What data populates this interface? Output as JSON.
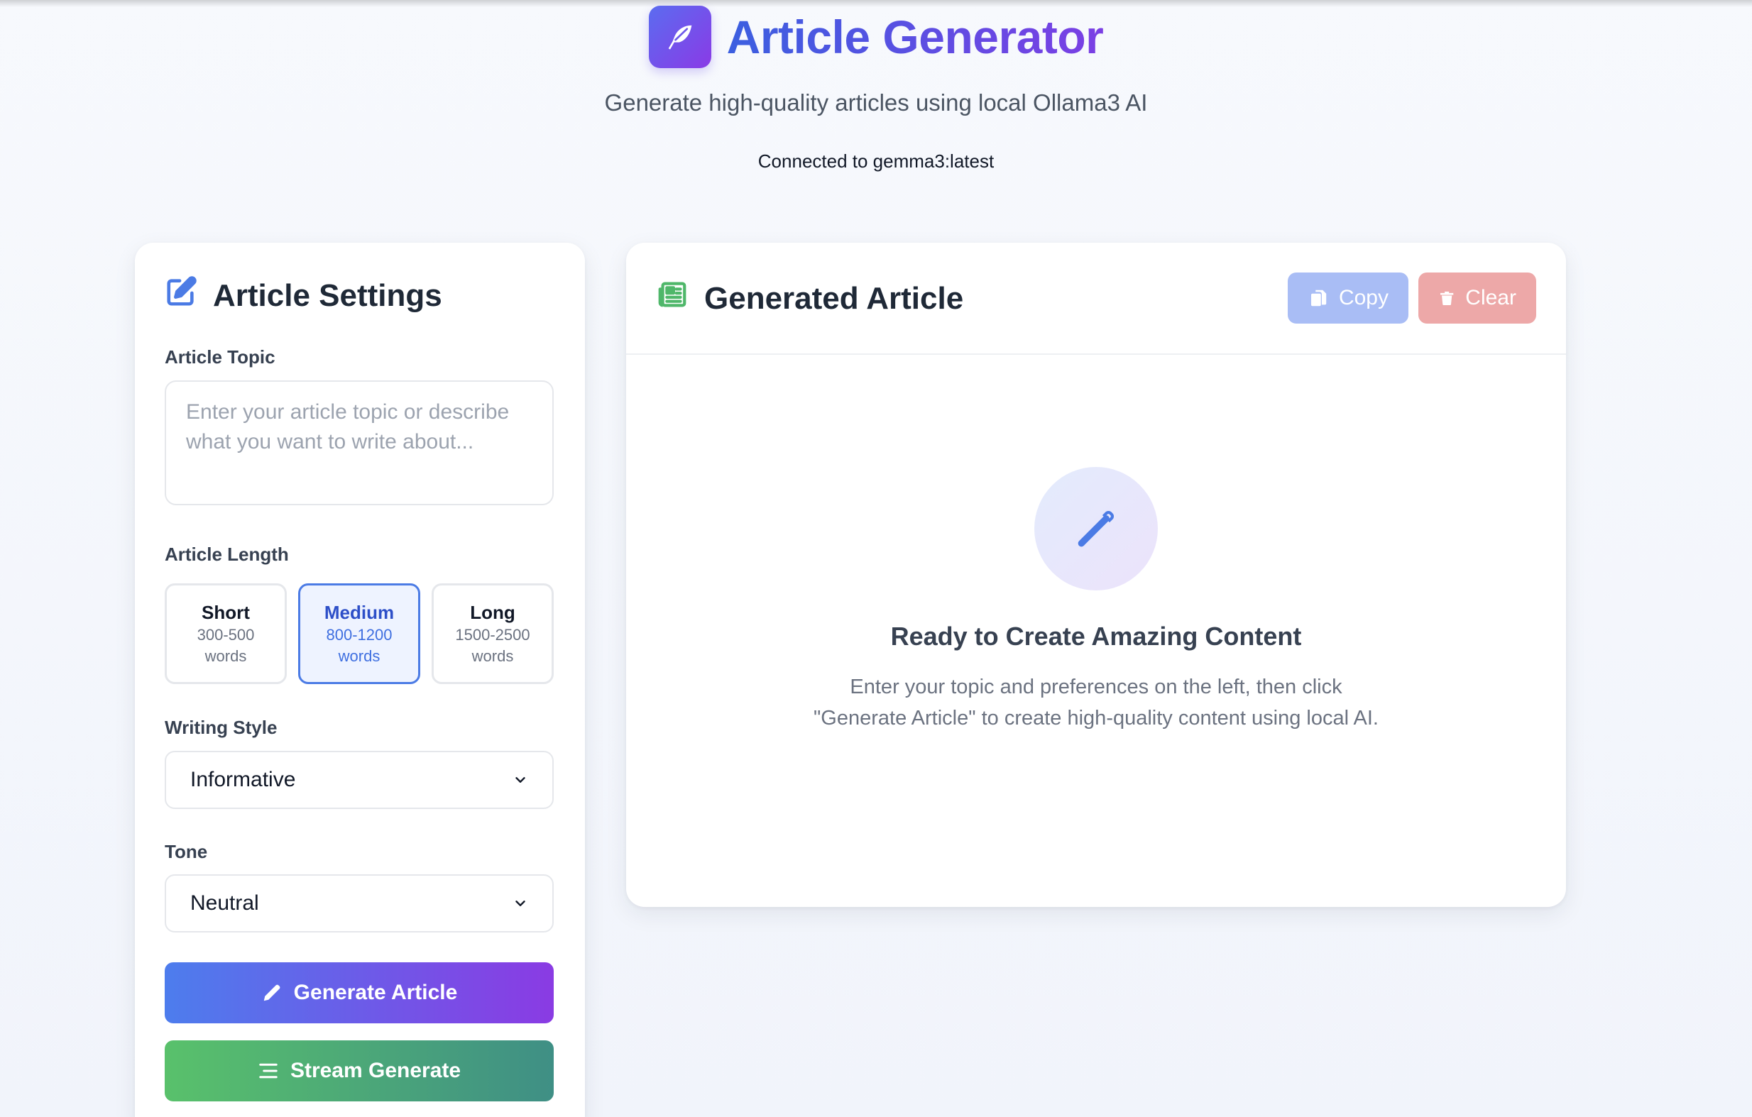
{
  "header": {
    "title": "Article Generator",
    "subtitle": "Generate high-quality articles using local Ollama3 AI",
    "connection_status": "Connected to gemma3:latest",
    "logo_icon": "feather-icon"
  },
  "settings": {
    "title": "Article Settings",
    "title_icon": "edit-square-icon",
    "topic": {
      "label": "Article Topic",
      "placeholder": "Enter your article topic or describe what you want to write about...",
      "value": ""
    },
    "length": {
      "label": "Article Length",
      "selected": "Medium",
      "options": [
        {
          "name": "Short",
          "range": "300-500",
          "unit": "words"
        },
        {
          "name": "Medium",
          "range": "800-1200",
          "unit": "words"
        },
        {
          "name": "Long",
          "range": "1500-2500",
          "unit": "words"
        }
      ]
    },
    "style": {
      "label": "Writing Style",
      "value": "Informative"
    },
    "tone": {
      "label": "Tone",
      "value": "Neutral"
    },
    "generate_button": "Generate Article",
    "stream_button": "Stream Generate"
  },
  "article": {
    "title": "Generated Article",
    "title_icon": "newspaper-icon",
    "copy_button": "Copy",
    "clear_button": "Clear",
    "empty_state": {
      "icon": "pencil-icon",
      "title": "Ready to Create Amazing Content",
      "description": "Enter your topic and preferences on the left, then click \"Generate Article\" to create high-quality content using local AI."
    }
  },
  "colors": {
    "accent_start": "#4d7ded",
    "accent_end": "#8a3be3",
    "stream_start": "#59c16b",
    "stream_end": "#3f8f85",
    "copy_disabled": "#a9bdf5",
    "clear_disabled": "#eda8a8"
  }
}
